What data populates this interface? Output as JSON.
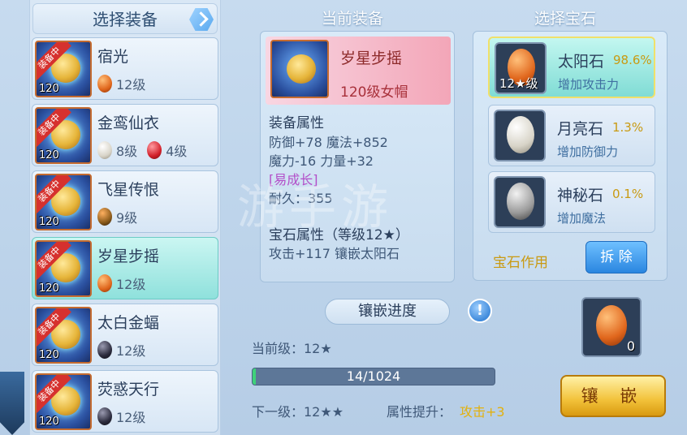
{
  "left_panel": {
    "title": "选择装备",
    "items": [
      {
        "name": "宿光",
        "badge": "装备中",
        "level": "120",
        "gems": [
          {
            "type": "sun",
            "label": "12级"
          }
        ]
      },
      {
        "name": "金鸾仙衣",
        "badge": "装备中",
        "level": "120",
        "gems": [
          {
            "type": "moon",
            "label": "8级"
          },
          {
            "type": "ruby",
            "label": "4级"
          }
        ]
      },
      {
        "name": "飞星传恨",
        "badge": "装备中",
        "level": "120",
        "gems": [
          {
            "type": "pair",
            "label": "9级"
          }
        ]
      },
      {
        "name": "岁星步摇",
        "badge": "装备中",
        "level": "120",
        "gems": [
          {
            "type": "sun",
            "label": "12级"
          }
        ],
        "selected": true
      },
      {
        "name": "太白金蝠",
        "badge": "装备中",
        "level": "120",
        "gems": [
          {
            "type": "dark",
            "label": "12级"
          }
        ]
      },
      {
        "name": "荧惑天行",
        "badge": "装备中",
        "level": "120",
        "gems": [
          {
            "type": "dark",
            "label": "12级"
          }
        ]
      }
    ]
  },
  "center": {
    "title": "当前装备",
    "equip_name": "岁星步摇",
    "equip_sub": "120级女帽",
    "attr_title": "装备属性",
    "attr_line1": "防御+78 魔法+852",
    "attr_line2": "魔力-16 力量+32",
    "attr_tag": "[易成长]",
    "durability": "耐久：355",
    "gem_attr_title": "宝石属性（等级12★）",
    "gem_attr_line": "攻击+117 镶嵌太阳石",
    "watermark": "游手游"
  },
  "right": {
    "title": "选择宝石",
    "gems": [
      {
        "name": "太阳石",
        "pct": "98.6%",
        "desc": "增加攻击力",
        "count": "12★级",
        "type": "sun",
        "selected": true
      },
      {
        "name": "月亮石",
        "pct": "1.3%",
        "desc": "增加防御力",
        "count": "",
        "type": "moon"
      },
      {
        "name": "神秘石",
        "pct": "0.1%",
        "desc": "增加魔法",
        "count": "",
        "type": "moon"
      }
    ],
    "effect_label": "宝石作用",
    "remove_button": "拆 除"
  },
  "progress": {
    "title": "镶嵌进度",
    "help": "!",
    "current_level_label": "当前级：12★",
    "bar_text": "14/1024",
    "bar_fraction": 0.0137,
    "next_level_label": "下一级：12★★",
    "attr_gain_label": "属性提升：",
    "attr_gain_value": "攻击+3",
    "slot_count": "0",
    "inlay_button": "镶 嵌"
  },
  "colors": {
    "accent_gold": "#f2c23a",
    "selected_teal": "#8fe1dc",
    "badge_red": "#d6312e",
    "gain_yellow": "#e3b10d"
  }
}
